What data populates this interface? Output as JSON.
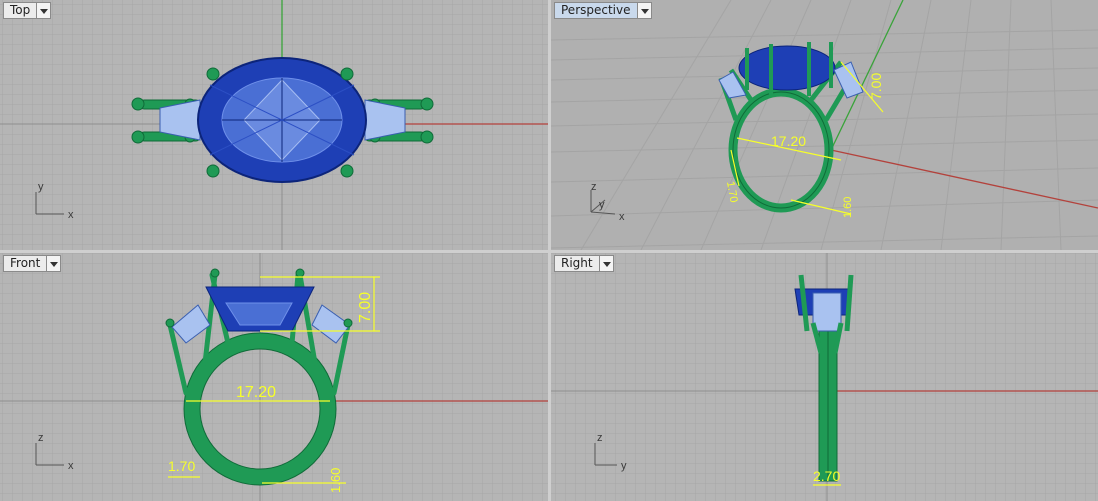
{
  "viewports": {
    "top": {
      "label": "Top",
      "axes": [
        "y",
        "x"
      ]
    },
    "perspective": {
      "label": "Perspective",
      "axes": [
        "z",
        "y",
        "x"
      ]
    },
    "front": {
      "label": "Front",
      "axes": [
        "z",
        "x"
      ]
    },
    "right": {
      "label": "Right",
      "axes": [
        "z",
        "y"
      ]
    }
  },
  "dimensions": {
    "height": "7.00",
    "width": "17.20",
    "band_side": "1.70",
    "band_bottom": "1.60",
    "band_width": "2.70"
  },
  "colors": {
    "background": "#b5b5b5",
    "grid_minor": "#a6a6a6",
    "grid_major": "#8e8e8e",
    "x_axis": "#b3423c",
    "y_axis": "#3aa33a",
    "metal": "#1f9a55",
    "metal_dark": "#0f6b38",
    "gem": "#1e3fb5",
    "gem_light": "#5a80e0",
    "side_stone": "#a9c2f0",
    "dimension": "#f6ff2a"
  }
}
